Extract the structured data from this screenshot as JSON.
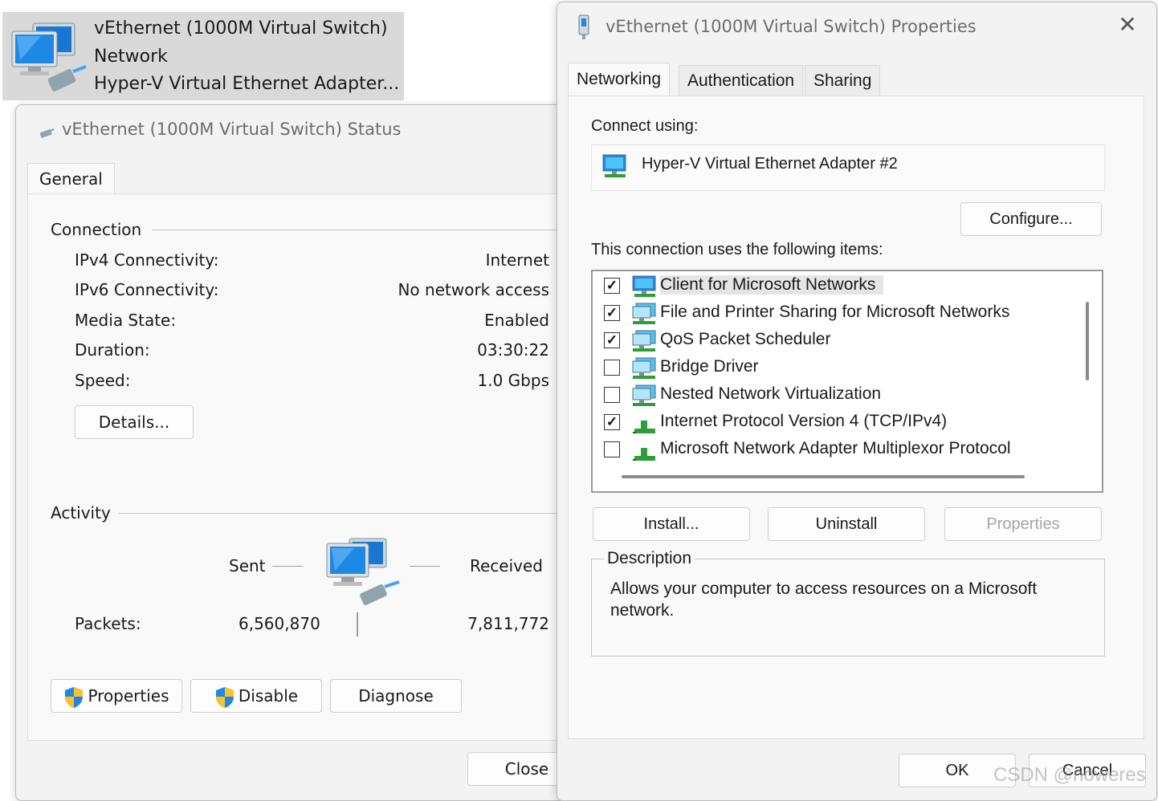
{
  "tile": {
    "name": "vEthernet (1000M Virtual Switch)",
    "type": "Network",
    "adapter": "Hyper-V Virtual Ethernet Adapter..."
  },
  "status": {
    "title": "vEthernet (1000M Virtual Switch) Status",
    "tab": "General",
    "connection": {
      "heading": "Connection",
      "rows": [
        {
          "label": "IPv4 Connectivity:",
          "value": "Internet"
        },
        {
          "label": "IPv6 Connectivity:",
          "value": "No network access"
        },
        {
          "label": "Media State:",
          "value": "Enabled"
        },
        {
          "label": "Duration:",
          "value": "03:30:22"
        },
        {
          "label": "Speed:",
          "value": "1.0 Gbps"
        }
      ],
      "details_label": "Details..."
    },
    "activity": {
      "heading": "Activity",
      "sent_label": "Sent",
      "received_label": "Received",
      "packets_label": "Packets:",
      "packets_sent": "6,560,870",
      "packets_received": "7,811,772"
    },
    "buttons": {
      "properties": "Properties",
      "disable": "Disable",
      "diagnose": "Diagnose",
      "close": "Close"
    }
  },
  "props": {
    "title": "vEthernet (1000M Virtual Switch) Properties",
    "tabs": [
      "Networking",
      "Authentication",
      "Sharing"
    ],
    "connect_using_label": "Connect using:",
    "adapter_name": "Hyper-V Virtual Ethernet Adapter #2",
    "configure_label": "Configure...",
    "items_label": "This connection uses the following items:",
    "items": [
      {
        "label": "Client for Microsoft Networks",
        "checked": true,
        "icon": "network-client-icon"
      },
      {
        "label": "File and Printer Sharing for Microsoft Networks",
        "checked": true,
        "icon": "network-service-icon"
      },
      {
        "label": "QoS Packet Scheduler",
        "checked": true,
        "icon": "network-service-icon"
      },
      {
        "label": "Bridge Driver",
        "checked": false,
        "icon": "network-service-icon"
      },
      {
        "label": "Nested Network Virtualization",
        "checked": false,
        "icon": "network-service-icon"
      },
      {
        "label": "Internet Protocol Version 4 (TCP/IPv4)",
        "checked": true,
        "icon": "protocol-icon"
      },
      {
        "label": "Microsoft Network Adapter Multiplexor Protocol",
        "checked": false,
        "icon": "protocol-icon"
      }
    ],
    "install_label": "Install...",
    "uninstall_label": "Uninstall",
    "properties_label": "Properties",
    "description_heading": "Description",
    "description_text": "Allows your computer to access resources on a Microsoft network.",
    "ok_label": "OK",
    "cancel_label": "Cancel"
  },
  "watermark": "CSDN @noweres",
  "colors": {
    "accent_blue": "#1e88e5",
    "protocol_green": "#2e9e3a",
    "disabled_text": "#a6a6a6"
  }
}
